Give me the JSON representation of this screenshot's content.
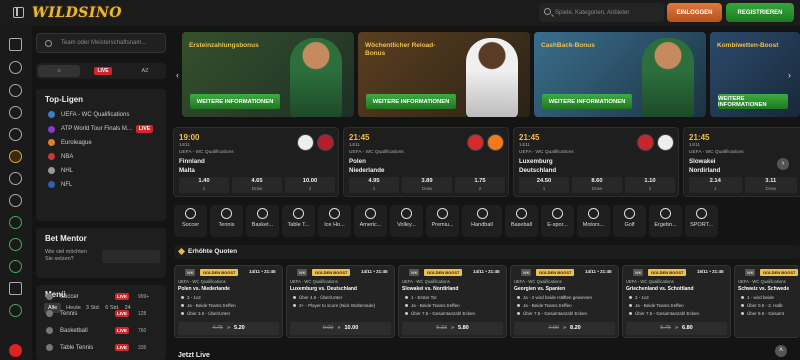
{
  "header": {
    "logo": "WILDSINO",
    "search_placeholder": "Spiele, Kategorien, Anbieter",
    "login": "EINLOGGEN",
    "register": "REGISTRIEREN"
  },
  "left": {
    "search_placeholder": "Team oder Meisterschaftsnam...",
    "tabs": {
      "live": "LIVE",
      "az": "AZ"
    },
    "top_ligen_title": "Top-Ligen",
    "leagues": [
      {
        "name": "UEFA - WC Qualifications",
        "live": ""
      },
      {
        "name": "ATP World Tour Finals M...",
        "live": "LIVE"
      },
      {
        "name": "Euroleague",
        "live": ""
      },
      {
        "name": "NBA",
        "live": ""
      },
      {
        "name": "NHL",
        "live": ""
      },
      {
        "name": "NFL",
        "live": ""
      }
    ],
    "bet_mentor_title": "Bet Mentor",
    "bet_mentor_question": "Wie viel möchten Sie setzen?",
    "menu_title": "Menü",
    "menu_tabs": [
      "Alle",
      "Heute",
      "3 Std.",
      "6 Std.",
      "24"
    ],
    "sports": [
      {
        "name": "Soccer",
        "live": "LIVE",
        "count": "999+"
      },
      {
        "name": "Tennis",
        "live": "LIVE",
        "count": "128"
      },
      {
        "name": "Basketball",
        "live": "LIVE",
        "count": "760"
      },
      {
        "name": "Table Tennis",
        "live": "LIVE",
        "count": "335"
      }
    ]
  },
  "banners": [
    {
      "title": "Ersteinzahlungsbonus",
      "cta": "WEITERE INFORMATIONEN"
    },
    {
      "title": "Wöchentlicher Reload-Bonus",
      "cta": "WEITERE INFORMATIONEN"
    },
    {
      "title": "CashBack-Bonus",
      "cta": "WEITERE INFORMATIONEN"
    },
    {
      "title": "Kombiwetten-Boost",
      "cta": "WEITERE INFORMATIONEN"
    }
  ],
  "matches": [
    {
      "time": "19:00",
      "date": "14/11",
      "league": "UEFA - WC Qualifications",
      "team1": "Finnland",
      "team2": "Malta",
      "odds": [
        [
          "1.40",
          "1"
        ],
        [
          "4.65",
          "Draw"
        ],
        [
          "10.00",
          "2"
        ]
      ]
    },
    {
      "time": "21:45",
      "date": "14/11",
      "league": "UEFA - WC Qualifications",
      "team1": "Polen",
      "team2": "Niederlande",
      "odds": [
        [
          "4.95",
          "1"
        ],
        [
          "3.89",
          "Draw"
        ],
        [
          "1.75",
          "2"
        ]
      ]
    },
    {
      "time": "21:45",
      "date": "14/11",
      "league": "UEFA - WC Qualifications",
      "team1": "Luxemburg",
      "team2": "Deutschland",
      "odds": [
        [
          "24.50",
          "1"
        ],
        [
          "8.60",
          "Draw"
        ],
        [
          "1.10",
          "2"
        ]
      ]
    },
    {
      "time": "21:45",
      "date": "14/11",
      "league": "UEFA - WC Qualifications",
      "team1": "Slowakei",
      "team2": "Nordirland",
      "odds": [
        [
          "2.14",
          "1"
        ],
        [
          "3.11",
          "Draw"
        ],
        [
          "",
          ""
        ]
      ]
    }
  ],
  "sport_strip": [
    "Soccer",
    "Tennis",
    "Basket...",
    "Table T...",
    "Ice Ho...",
    "Americ...",
    "Volley...",
    "Premiu...",
    "Handball",
    "Baseball",
    "E-spor...",
    "Motors...",
    "Golf",
    "Ergebn...",
    "SPORT..."
  ],
  "boost_header": "Erhöhte Quoten",
  "boosts": [
    {
      "wk": "WK",
      "tag": "GOLDEN BOOST",
      "date": "14/11 • 21:45",
      "league": "UEFA - WC Qualifications",
      "match": "Polen vs. Niederlande",
      "lines": [
        "2 - 1x2",
        "Ja - Beide Teams treffen",
        "Über 3.5 - Über/Unter"
      ],
      "old": "4.75",
      "new": "5.20"
    },
    {
      "wk": "WK",
      "tag": "GOLDEN BOOST",
      "date": "14/11 • 21:45",
      "league": "UEFA - WC Qualifications",
      "match": "Luxemburg vs. Deutschland",
      "lines": [
        "Über 4.5 - Über/Unter",
        "2+ - Player to score (Nick Woltemade)",
        ""
      ],
      "old": "9.00",
      "new": "10.00"
    },
    {
      "wk": "WK",
      "tag": "GOLDEN BOOST",
      "date": "14/11 • 21:45",
      "league": "UEFA - WC Qualifications",
      "match": "Slowakei vs. Nordirland",
      "lines": [
        "1 - Erster Tor",
        "Ja - Beide Teams treffen",
        "Über 7.5 - Gesamtanzahl Ecken"
      ],
      "old": "5.33",
      "new": "5.80"
    },
    {
      "wk": "WK",
      "tag": "GOLDEN BOOST",
      "date": "14/11 • 21:45",
      "league": "UEFA - WC Qualifications",
      "match": "Georgien vs. Spanien",
      "lines": [
        "Ja - 2 wird beide Hälften gewinnen",
        "Ja - Beide Teams treffen",
        "Über 7.5 - Gesamtanzahl Ecken"
      ],
      "old": "7.99",
      "new": "8.20"
    },
    {
      "wk": "WK",
      "tag": "GOLDEN BOOST",
      "date": "15/11 • 21:45",
      "league": "UEFA - WC Qualifications",
      "match": "Griechenland vs. Schottland",
      "lines": [
        "2 - 1x2",
        "Ja - Beide Teams treffen",
        "Über 7.5 - Gesamtanzahl Ecken"
      ],
      "old": "5.75",
      "new": "6.80"
    },
    {
      "wk": "WK",
      "tag": "GOLDEN BOOST",
      "date": "15/11 • 21:45",
      "league": "UEFA - WC Qualifications",
      "match": "Schweiz vs. Schwede",
      "lines": [
        "1 - wird beide",
        "Über 0.5 - 2. Halb",
        "Über 9.5 - Gesamt"
      ],
      "old": "",
      "new": ""
    }
  ],
  "jetzt_live": "Jetzt Live"
}
